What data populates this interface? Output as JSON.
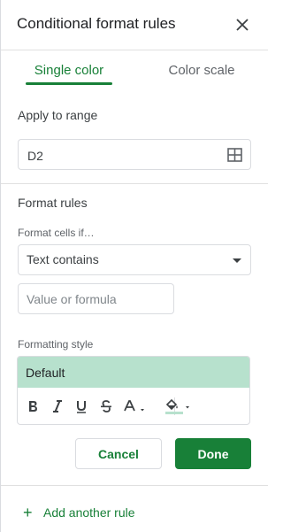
{
  "panel": {
    "title": "Conditional format rules",
    "close_icon": "close-icon"
  },
  "tabs": [
    {
      "label": "Single color",
      "active": true
    },
    {
      "label": "Color scale",
      "active": false
    }
  ],
  "apply_to_range": {
    "label": "Apply to range",
    "value": "D2",
    "icon": "grid-select-icon"
  },
  "format_rules": {
    "label": "Format rules",
    "condition_label": "Format cells if…",
    "condition_value": "Text contains",
    "value_placeholder": "Value or formula"
  },
  "formatting_style": {
    "label": "Formatting style",
    "preview_text": "Default",
    "preview_color": "#b7e1cd",
    "tools": [
      "bold-icon",
      "italic-icon",
      "underline-icon",
      "strikethrough-icon",
      "text-color-icon",
      "fill-color-icon"
    ]
  },
  "buttons": {
    "cancel": "Cancel",
    "done": "Done"
  },
  "add_rule": {
    "plus": "+",
    "label": "Add another rule"
  },
  "colors": {
    "accent": "#188038",
    "preview": "#b7e1cd",
    "border": "#dadce0"
  }
}
